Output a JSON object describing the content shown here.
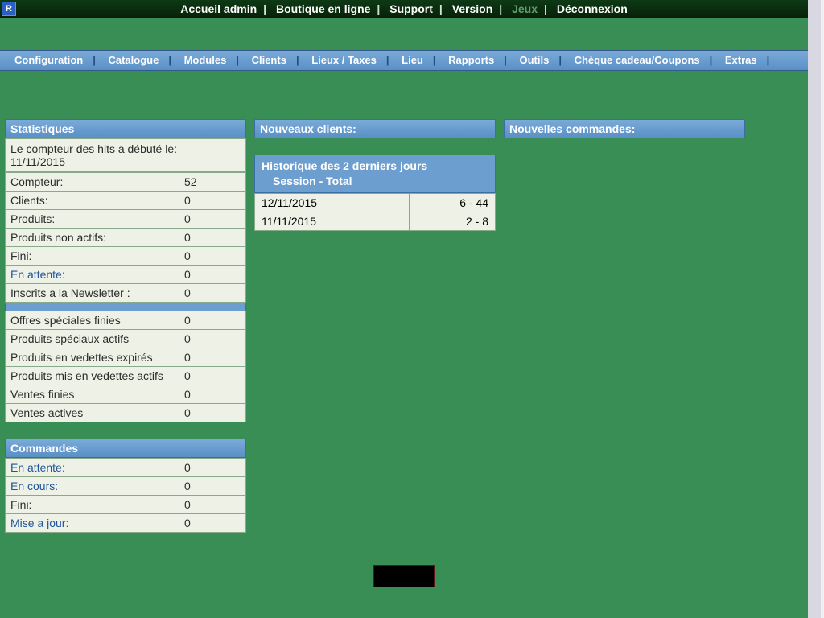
{
  "badge": "R",
  "topnav": {
    "items": [
      "Accueil admin",
      "Boutique en ligne",
      "Support",
      "Version",
      "Jeux",
      "Déconnexion"
    ],
    "muted_index": 4
  },
  "subnav": {
    "items": [
      "Configuration",
      "Catalogue",
      "Modules",
      "Clients",
      "Lieux / Taxes",
      "Lieu",
      "Rapports",
      "Outils",
      "Chèque cadeau/Coupons",
      "Extras"
    ]
  },
  "stats": {
    "title": "Statistiques",
    "intro": "Le compteur des hits a débuté le:",
    "intro_date": "11/11/2015",
    "rows1": [
      {
        "label": "Compteur:",
        "value": "52",
        "link": false
      },
      {
        "label": "Clients:",
        "value": "0",
        "link": false
      },
      {
        "label": "Produits:",
        "value": "0",
        "link": false
      },
      {
        "label": "Produits non actifs:",
        "value": "0",
        "link": false
      },
      {
        "label": "Fini:",
        "value": "0",
        "link": false
      },
      {
        "label": "En attente:",
        "value": "0",
        "link": true
      },
      {
        "label": "Inscrits a la Newsletter :",
        "value": "0",
        "link": false
      }
    ],
    "rows2": [
      {
        "label": "Offres spéciales finies",
        "value": "0",
        "link": false
      },
      {
        "label": "Produits spéciaux actifs",
        "value": "0",
        "link": false
      },
      {
        "label": "Produits en vedettes expirés",
        "value": "0",
        "link": false
      },
      {
        "label": "Produits mis en vedettes actifs",
        "value": "0",
        "link": false
      },
      {
        "label": "Ventes finies",
        "value": "0",
        "link": false
      },
      {
        "label": "Ventes actives",
        "value": "0",
        "link": false
      }
    ]
  },
  "orders": {
    "title": "Commandes",
    "rows": [
      {
        "label": "En attente:",
        "value": "0",
        "link": true
      },
      {
        "label": "En cours:",
        "value": "0",
        "link": true
      },
      {
        "label": "Fini:",
        "value": "0",
        "link": false
      },
      {
        "label": "Mise a jour:",
        "value": "0",
        "link": true
      }
    ]
  },
  "new_clients": {
    "title": "Nouveaux clients:",
    "history_title": "Historique des 2 derniers jours",
    "history_sub": "Session - Total",
    "rows": [
      {
        "date": "12/11/2015",
        "val": "6 - 44"
      },
      {
        "date": "11/11/2015",
        "val": "2 - 8"
      }
    ]
  },
  "new_orders": {
    "title": "Nouvelles commandes:"
  },
  "footer_logo_text": ""
}
